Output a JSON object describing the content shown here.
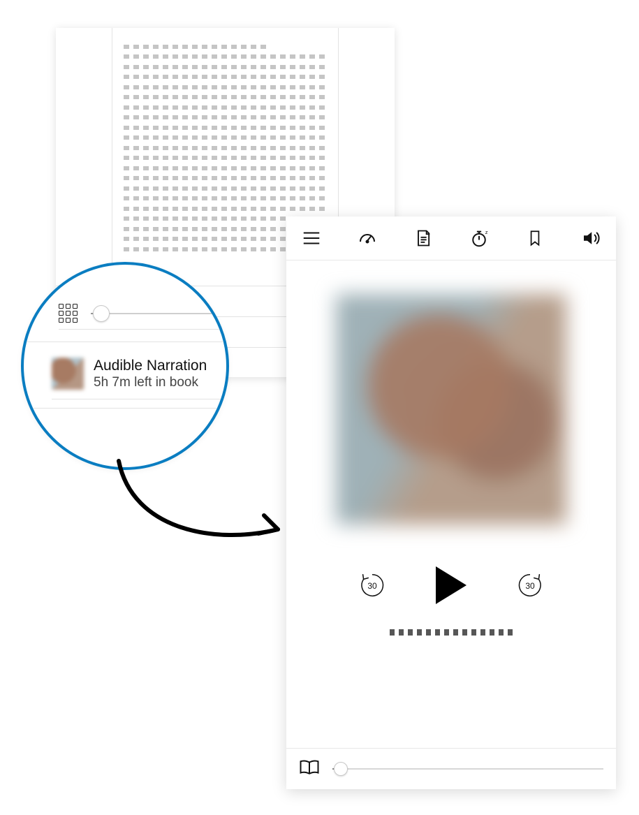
{
  "callout": {
    "title": "Audible Narration",
    "subtitle": "5h 7m left in book",
    "font_slider_percent": 8
  },
  "player": {
    "toolbar": {
      "menu": "menu",
      "speed": "speed",
      "chapters": "chapters",
      "sleep": "sleep",
      "bookmark": "bookmark",
      "volume": "volume"
    },
    "skip_back_seconds": "30",
    "skip_fwd_seconds": "30",
    "progress_percent": 3
  },
  "colors": {
    "accent": "#0a7dc1"
  }
}
